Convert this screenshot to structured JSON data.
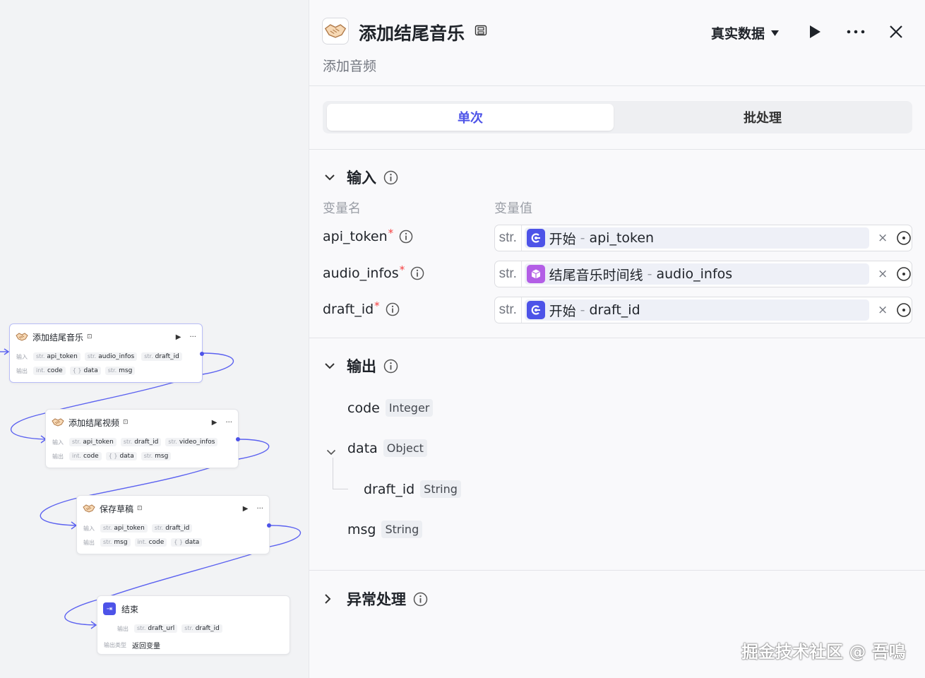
{
  "canvas": {
    "nodes": [
      {
        "title": "添加结尾音乐",
        "input_label": "输入",
        "inputs": [
          {
            "type": "str.",
            "name": "api_token"
          },
          {
            "type": "str.",
            "name": "audio_infos"
          },
          {
            "type": "str.",
            "name": "draft_id"
          }
        ],
        "output_label": "输出",
        "outputs": [
          {
            "type": "int.",
            "name": "code"
          },
          {
            "type": "{ }",
            "name": "data"
          },
          {
            "type": "str.",
            "name": "msg"
          }
        ]
      },
      {
        "title": "添加结尾视频",
        "input_label": "输入",
        "inputs": [
          {
            "type": "str.",
            "name": "api_token"
          },
          {
            "type": "str.",
            "name": "draft_id"
          },
          {
            "type": "str.",
            "name": "video_infos"
          }
        ],
        "output_label": "输出",
        "outputs": [
          {
            "type": "int.",
            "name": "code"
          },
          {
            "type": "{ }",
            "name": "data"
          },
          {
            "type": "str.",
            "name": "msg"
          }
        ]
      },
      {
        "title": "保存草稿",
        "input_label": "输入",
        "inputs": [
          {
            "type": "str.",
            "name": "api_token"
          },
          {
            "type": "str.",
            "name": "draft_id"
          }
        ],
        "output_label": "输出",
        "outputs": [
          {
            "type": "str.",
            "name": "msg"
          },
          {
            "type": "int.",
            "name": "code"
          },
          {
            "type": "{ }",
            "name": "data"
          }
        ]
      }
    ],
    "end_node": {
      "title": "结束",
      "output_label": "输出",
      "outputs": [
        {
          "type": "str.",
          "name": "draft_url"
        },
        {
          "type": "str.",
          "name": "draft_id"
        }
      ],
      "output_type_label": "输出类型",
      "output_type_value": "返回变量"
    }
  },
  "panel": {
    "title": "添加结尾音乐",
    "subtitle": "添加音频",
    "data_mode": "真实数据",
    "tabs": [
      {
        "label": "单次",
        "active": true
      },
      {
        "label": "批处理",
        "active": false
      }
    ],
    "input_section": {
      "title": "输入",
      "col_name": "变量名",
      "col_value": "变量值",
      "rows": [
        {
          "name": "api_token",
          "required": "*",
          "type": "str.",
          "ref_node": "开始",
          "ref_sep": "-",
          "ref_var": "api_token",
          "ref_icon": "start-node-icon",
          "ref_color": "#4d53e8"
        },
        {
          "name": "audio_infos",
          "required": "*",
          "type": "str.",
          "ref_node": "结尾音乐时间线",
          "ref_sep": "-",
          "ref_var": "audio_infos",
          "ref_icon": "plugin-cube-icon",
          "ref_color": "#b35ee6"
        },
        {
          "name": "draft_id",
          "required": "*",
          "type": "str.",
          "ref_node": "开始",
          "ref_sep": "-",
          "ref_var": "draft_id",
          "ref_icon": "start-node-icon",
          "ref_color": "#4d53e8"
        }
      ]
    },
    "output_section": {
      "title": "输出",
      "fields": [
        {
          "name": "code",
          "type": "Integer"
        },
        {
          "name": "data",
          "type": "Object"
        },
        {
          "name": "draft_id",
          "type": "String"
        },
        {
          "name": "msg",
          "type": "String"
        }
      ]
    },
    "error_section": {
      "title": "异常处理"
    },
    "watermark": "掘金技术社区 @ 吾鳴"
  },
  "colors": {
    "accent": "#4d53e8",
    "required": "#f53f3f",
    "plugin": "#b35ee6"
  }
}
